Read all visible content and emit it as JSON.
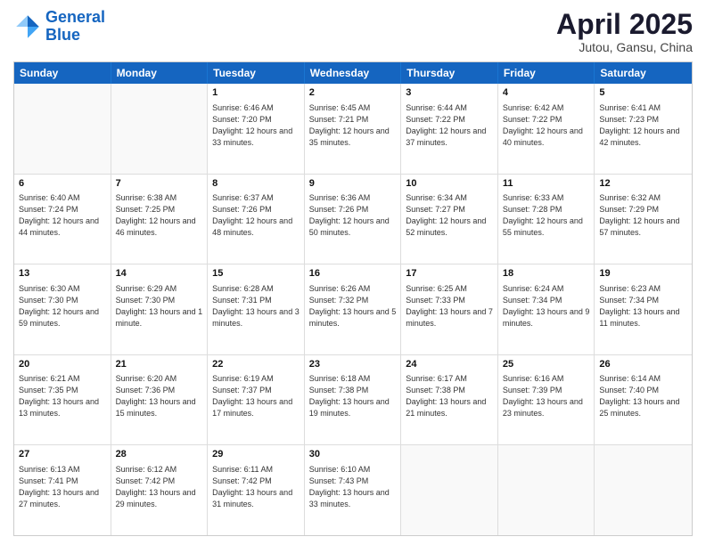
{
  "logo": {
    "line1": "General",
    "line2": "Blue"
  },
  "title": "April 2025",
  "subtitle": "Jutou, Gansu, China",
  "days": [
    "Sunday",
    "Monday",
    "Tuesday",
    "Wednesday",
    "Thursday",
    "Friday",
    "Saturday"
  ],
  "rows": [
    [
      {
        "day": "",
        "info": ""
      },
      {
        "day": "",
        "info": ""
      },
      {
        "day": "1",
        "info": "Sunrise: 6:46 AM\nSunset: 7:20 PM\nDaylight: 12 hours and 33 minutes."
      },
      {
        "day": "2",
        "info": "Sunrise: 6:45 AM\nSunset: 7:21 PM\nDaylight: 12 hours and 35 minutes."
      },
      {
        "day": "3",
        "info": "Sunrise: 6:44 AM\nSunset: 7:22 PM\nDaylight: 12 hours and 37 minutes."
      },
      {
        "day": "4",
        "info": "Sunrise: 6:42 AM\nSunset: 7:22 PM\nDaylight: 12 hours and 40 minutes."
      },
      {
        "day": "5",
        "info": "Sunrise: 6:41 AM\nSunset: 7:23 PM\nDaylight: 12 hours and 42 minutes."
      }
    ],
    [
      {
        "day": "6",
        "info": "Sunrise: 6:40 AM\nSunset: 7:24 PM\nDaylight: 12 hours and 44 minutes."
      },
      {
        "day": "7",
        "info": "Sunrise: 6:38 AM\nSunset: 7:25 PM\nDaylight: 12 hours and 46 minutes."
      },
      {
        "day": "8",
        "info": "Sunrise: 6:37 AM\nSunset: 7:26 PM\nDaylight: 12 hours and 48 minutes."
      },
      {
        "day": "9",
        "info": "Sunrise: 6:36 AM\nSunset: 7:26 PM\nDaylight: 12 hours and 50 minutes."
      },
      {
        "day": "10",
        "info": "Sunrise: 6:34 AM\nSunset: 7:27 PM\nDaylight: 12 hours and 52 minutes."
      },
      {
        "day": "11",
        "info": "Sunrise: 6:33 AM\nSunset: 7:28 PM\nDaylight: 12 hours and 55 minutes."
      },
      {
        "day": "12",
        "info": "Sunrise: 6:32 AM\nSunset: 7:29 PM\nDaylight: 12 hours and 57 minutes."
      }
    ],
    [
      {
        "day": "13",
        "info": "Sunrise: 6:30 AM\nSunset: 7:30 PM\nDaylight: 12 hours and 59 minutes."
      },
      {
        "day": "14",
        "info": "Sunrise: 6:29 AM\nSunset: 7:30 PM\nDaylight: 13 hours and 1 minute."
      },
      {
        "day": "15",
        "info": "Sunrise: 6:28 AM\nSunset: 7:31 PM\nDaylight: 13 hours and 3 minutes."
      },
      {
        "day": "16",
        "info": "Sunrise: 6:26 AM\nSunset: 7:32 PM\nDaylight: 13 hours and 5 minutes."
      },
      {
        "day": "17",
        "info": "Sunrise: 6:25 AM\nSunset: 7:33 PM\nDaylight: 13 hours and 7 minutes."
      },
      {
        "day": "18",
        "info": "Sunrise: 6:24 AM\nSunset: 7:34 PM\nDaylight: 13 hours and 9 minutes."
      },
      {
        "day": "19",
        "info": "Sunrise: 6:23 AM\nSunset: 7:34 PM\nDaylight: 13 hours and 11 minutes."
      }
    ],
    [
      {
        "day": "20",
        "info": "Sunrise: 6:21 AM\nSunset: 7:35 PM\nDaylight: 13 hours and 13 minutes."
      },
      {
        "day": "21",
        "info": "Sunrise: 6:20 AM\nSunset: 7:36 PM\nDaylight: 13 hours and 15 minutes."
      },
      {
        "day": "22",
        "info": "Sunrise: 6:19 AM\nSunset: 7:37 PM\nDaylight: 13 hours and 17 minutes."
      },
      {
        "day": "23",
        "info": "Sunrise: 6:18 AM\nSunset: 7:38 PM\nDaylight: 13 hours and 19 minutes."
      },
      {
        "day": "24",
        "info": "Sunrise: 6:17 AM\nSunset: 7:38 PM\nDaylight: 13 hours and 21 minutes."
      },
      {
        "day": "25",
        "info": "Sunrise: 6:16 AM\nSunset: 7:39 PM\nDaylight: 13 hours and 23 minutes."
      },
      {
        "day": "26",
        "info": "Sunrise: 6:14 AM\nSunset: 7:40 PM\nDaylight: 13 hours and 25 minutes."
      }
    ],
    [
      {
        "day": "27",
        "info": "Sunrise: 6:13 AM\nSunset: 7:41 PM\nDaylight: 13 hours and 27 minutes."
      },
      {
        "day": "28",
        "info": "Sunrise: 6:12 AM\nSunset: 7:42 PM\nDaylight: 13 hours and 29 minutes."
      },
      {
        "day": "29",
        "info": "Sunrise: 6:11 AM\nSunset: 7:42 PM\nDaylight: 13 hours and 31 minutes."
      },
      {
        "day": "30",
        "info": "Sunrise: 6:10 AM\nSunset: 7:43 PM\nDaylight: 13 hours and 33 minutes."
      },
      {
        "day": "",
        "info": ""
      },
      {
        "day": "",
        "info": ""
      },
      {
        "day": "",
        "info": ""
      }
    ]
  ]
}
